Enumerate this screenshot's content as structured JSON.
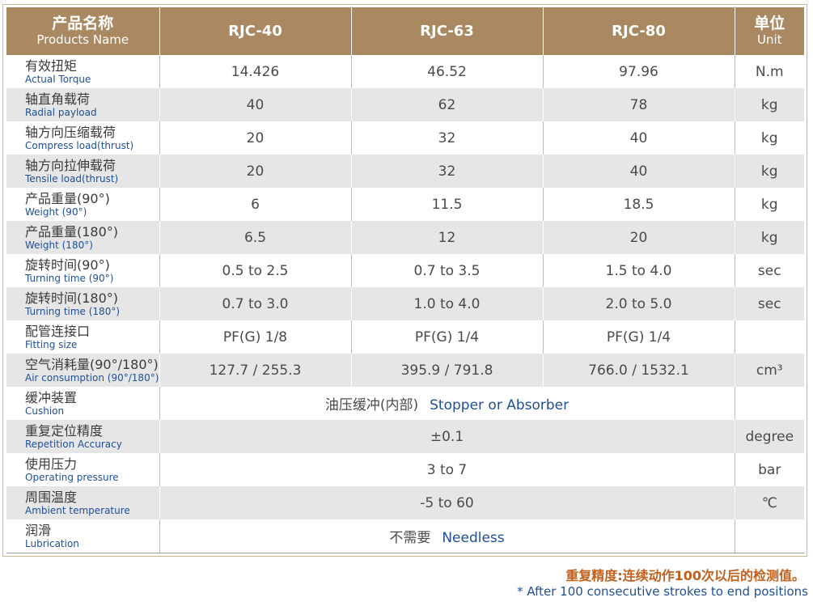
{
  "header": {
    "name_zh": "产品名称",
    "name_en": "Products Name",
    "models": [
      "RJC-40",
      "RJC-63",
      "RJC-80"
    ],
    "unit_zh": "单位",
    "unit_en": "Unit"
  },
  "rows": [
    {
      "zh": "有效扭矩",
      "en": "Actual Torque",
      "values": [
        "14.426",
        "46.52",
        "97.96"
      ],
      "unit": "N.m"
    },
    {
      "zh": "轴直角载荷",
      "en": "Radial payload",
      "values": [
        "40",
        "62",
        "78"
      ],
      "unit": "kg"
    },
    {
      "zh": "轴方向压缩载荷",
      "en": "Compress load(thrust)",
      "values": [
        "20",
        "32",
        "40"
      ],
      "unit": "kg"
    },
    {
      "zh": "轴方向拉伸载荷",
      "en": "Tensile load(thrust)",
      "values": [
        "20",
        "32",
        "40"
      ],
      "unit": "kg"
    },
    {
      "zh": "产品重量(90°)",
      "en": "Weight (90°)",
      "values": [
        "6",
        "11.5",
        "18.5"
      ],
      "unit": "kg"
    },
    {
      "zh": "产品重量(180°)",
      "en": "Weight (180°)",
      "values": [
        "6.5",
        "12",
        "20"
      ],
      "unit": "kg"
    },
    {
      "zh": "旋转时间(90°)",
      "en": "Turning time (90°)",
      "values": [
        "0.5 to 2.5",
        "0.7 to 3.5",
        "1.5 to 4.0"
      ],
      "unit": "sec"
    },
    {
      "zh": "旋转时间(180°)",
      "en": "Turning time (180°)",
      "values": [
        "0.7 to 3.0",
        "1.0 to 4.0",
        "2.0 to 5.0"
      ],
      "unit": "sec"
    },
    {
      "zh": "配管连接口",
      "en": "Fitting size",
      "values": [
        "PF(G) 1/8",
        "PF(G) 1/4",
        "PF(G) 1/4"
      ],
      "unit": ""
    },
    {
      "zh": "空气消耗量(90°/180°)",
      "en": "Air consumption (90°/180°)",
      "values": [
        "127.7 / 255.3",
        "395.9 / 791.8",
        "766.0 / 1532.1"
      ],
      "unit": "cm³"
    }
  ],
  "merged_rows": [
    {
      "zh": "缓冲装置",
      "en": "Cushion",
      "value_zh": "油压缓冲(内部)",
      "value_en": "Stopper or Absorber",
      "unit": ""
    },
    {
      "zh": "重复定位精度",
      "en": "Repetition Accuracy",
      "value_zh": "±0.1",
      "value_en": "",
      "unit": "degree"
    },
    {
      "zh": "使用压力",
      "en": "Operating pressure",
      "value_zh": "3 to 7",
      "value_en": "",
      "unit": "bar"
    },
    {
      "zh": "周围温度",
      "en": "Ambient temperature",
      "value_zh": "-5 to 60",
      "value_en": "",
      "unit": "℃"
    },
    {
      "zh": "润滑",
      "en": "Lubrication",
      "value_zh": "不需要",
      "value_en": "Needless",
      "unit": ""
    }
  ],
  "notes": {
    "zh": "重复精度:连续动作100次以后的检测值。",
    "en": "* After 100 consecutive strokes to end positions"
  },
  "colors": {
    "header_bg": "#a98862",
    "stripe": "#e6e6e6",
    "en_text": "#1f4f96",
    "note_zh": "#c0601c"
  }
}
